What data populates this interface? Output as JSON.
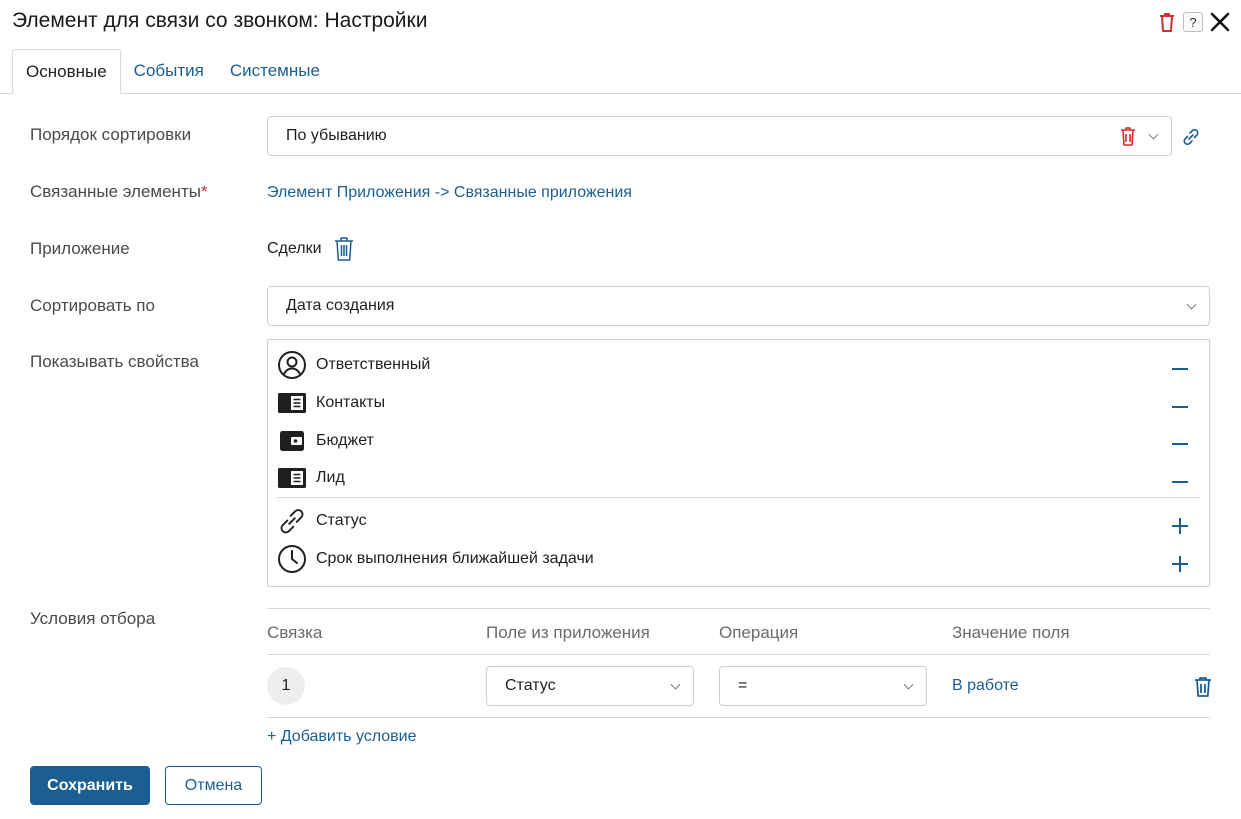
{
  "dialog": {
    "title": "Элемент для связи со звонком: Настройки",
    "help_label": "?"
  },
  "tabs": [
    {
      "label": "Основные",
      "active": true
    },
    {
      "label": "События",
      "active": false
    },
    {
      "label": "Системные",
      "active": false
    }
  ],
  "form": {
    "sort_order": {
      "label": "Порядок сортировки",
      "value": "По убыванию"
    },
    "related": {
      "label": "Связанные элементы",
      "required_mark": "*",
      "value": "Элемент Приложения -> Связанные приложения"
    },
    "app": {
      "label": "Приложение",
      "value": "Сделки"
    },
    "sort_by": {
      "label": "Сортировать по",
      "value": "Дата создания"
    },
    "show_props": {
      "label": "Показывать свойства",
      "shown": [
        {
          "label": "Ответственный",
          "icon": "user-circle-icon"
        },
        {
          "label": "Контакты",
          "icon": "list-card-icon"
        },
        {
          "label": "Бюджет",
          "icon": "wallet-icon"
        },
        {
          "label": "Лид",
          "icon": "list-card-icon"
        }
      ],
      "available": [
        {
          "label": "Статус",
          "icon": "link-icon"
        },
        {
          "label": "Срок выполнения ближайшей задачи",
          "icon": "clock-icon"
        }
      ]
    },
    "conditions": {
      "label": "Условия отбора",
      "headers": [
        "Связка",
        "Поле из приложения",
        "Операция",
        "Значение поля"
      ],
      "rows": [
        {
          "num": "1",
          "field": "Статус",
          "operation": "=",
          "value": "В работе"
        }
      ],
      "add_label": "+ Добавить условие"
    }
  },
  "buttons": {
    "save": "Сохранить",
    "cancel": "Отмена"
  },
  "colors": {
    "accent": "#1b5e93",
    "danger": "#d12f2f",
    "border": "#cfcfcf"
  }
}
